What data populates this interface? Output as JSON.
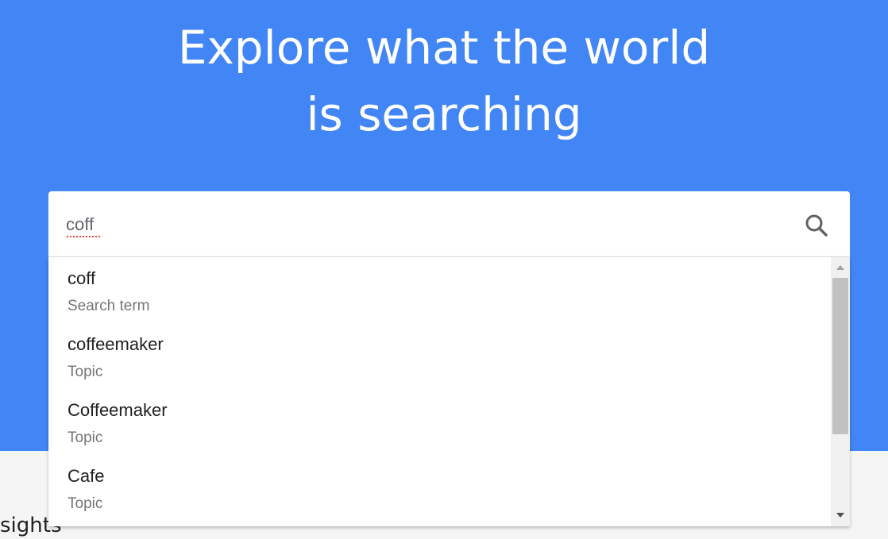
{
  "hero": {
    "title_line1": "Explore what the world",
    "title_line2": "is searching",
    "background_color": "#4285f4"
  },
  "search": {
    "value": "coff",
    "icon": "search-icon"
  },
  "suggestions": [
    {
      "name": "coff",
      "type": "Search term"
    },
    {
      "name": "coffeemaker",
      "type": "Topic"
    },
    {
      "name": "Coffeemaker",
      "type": "Topic"
    },
    {
      "name": "Cafe",
      "type": "Topic"
    }
  ],
  "lower_section": {
    "partial_heading": "sights"
  }
}
